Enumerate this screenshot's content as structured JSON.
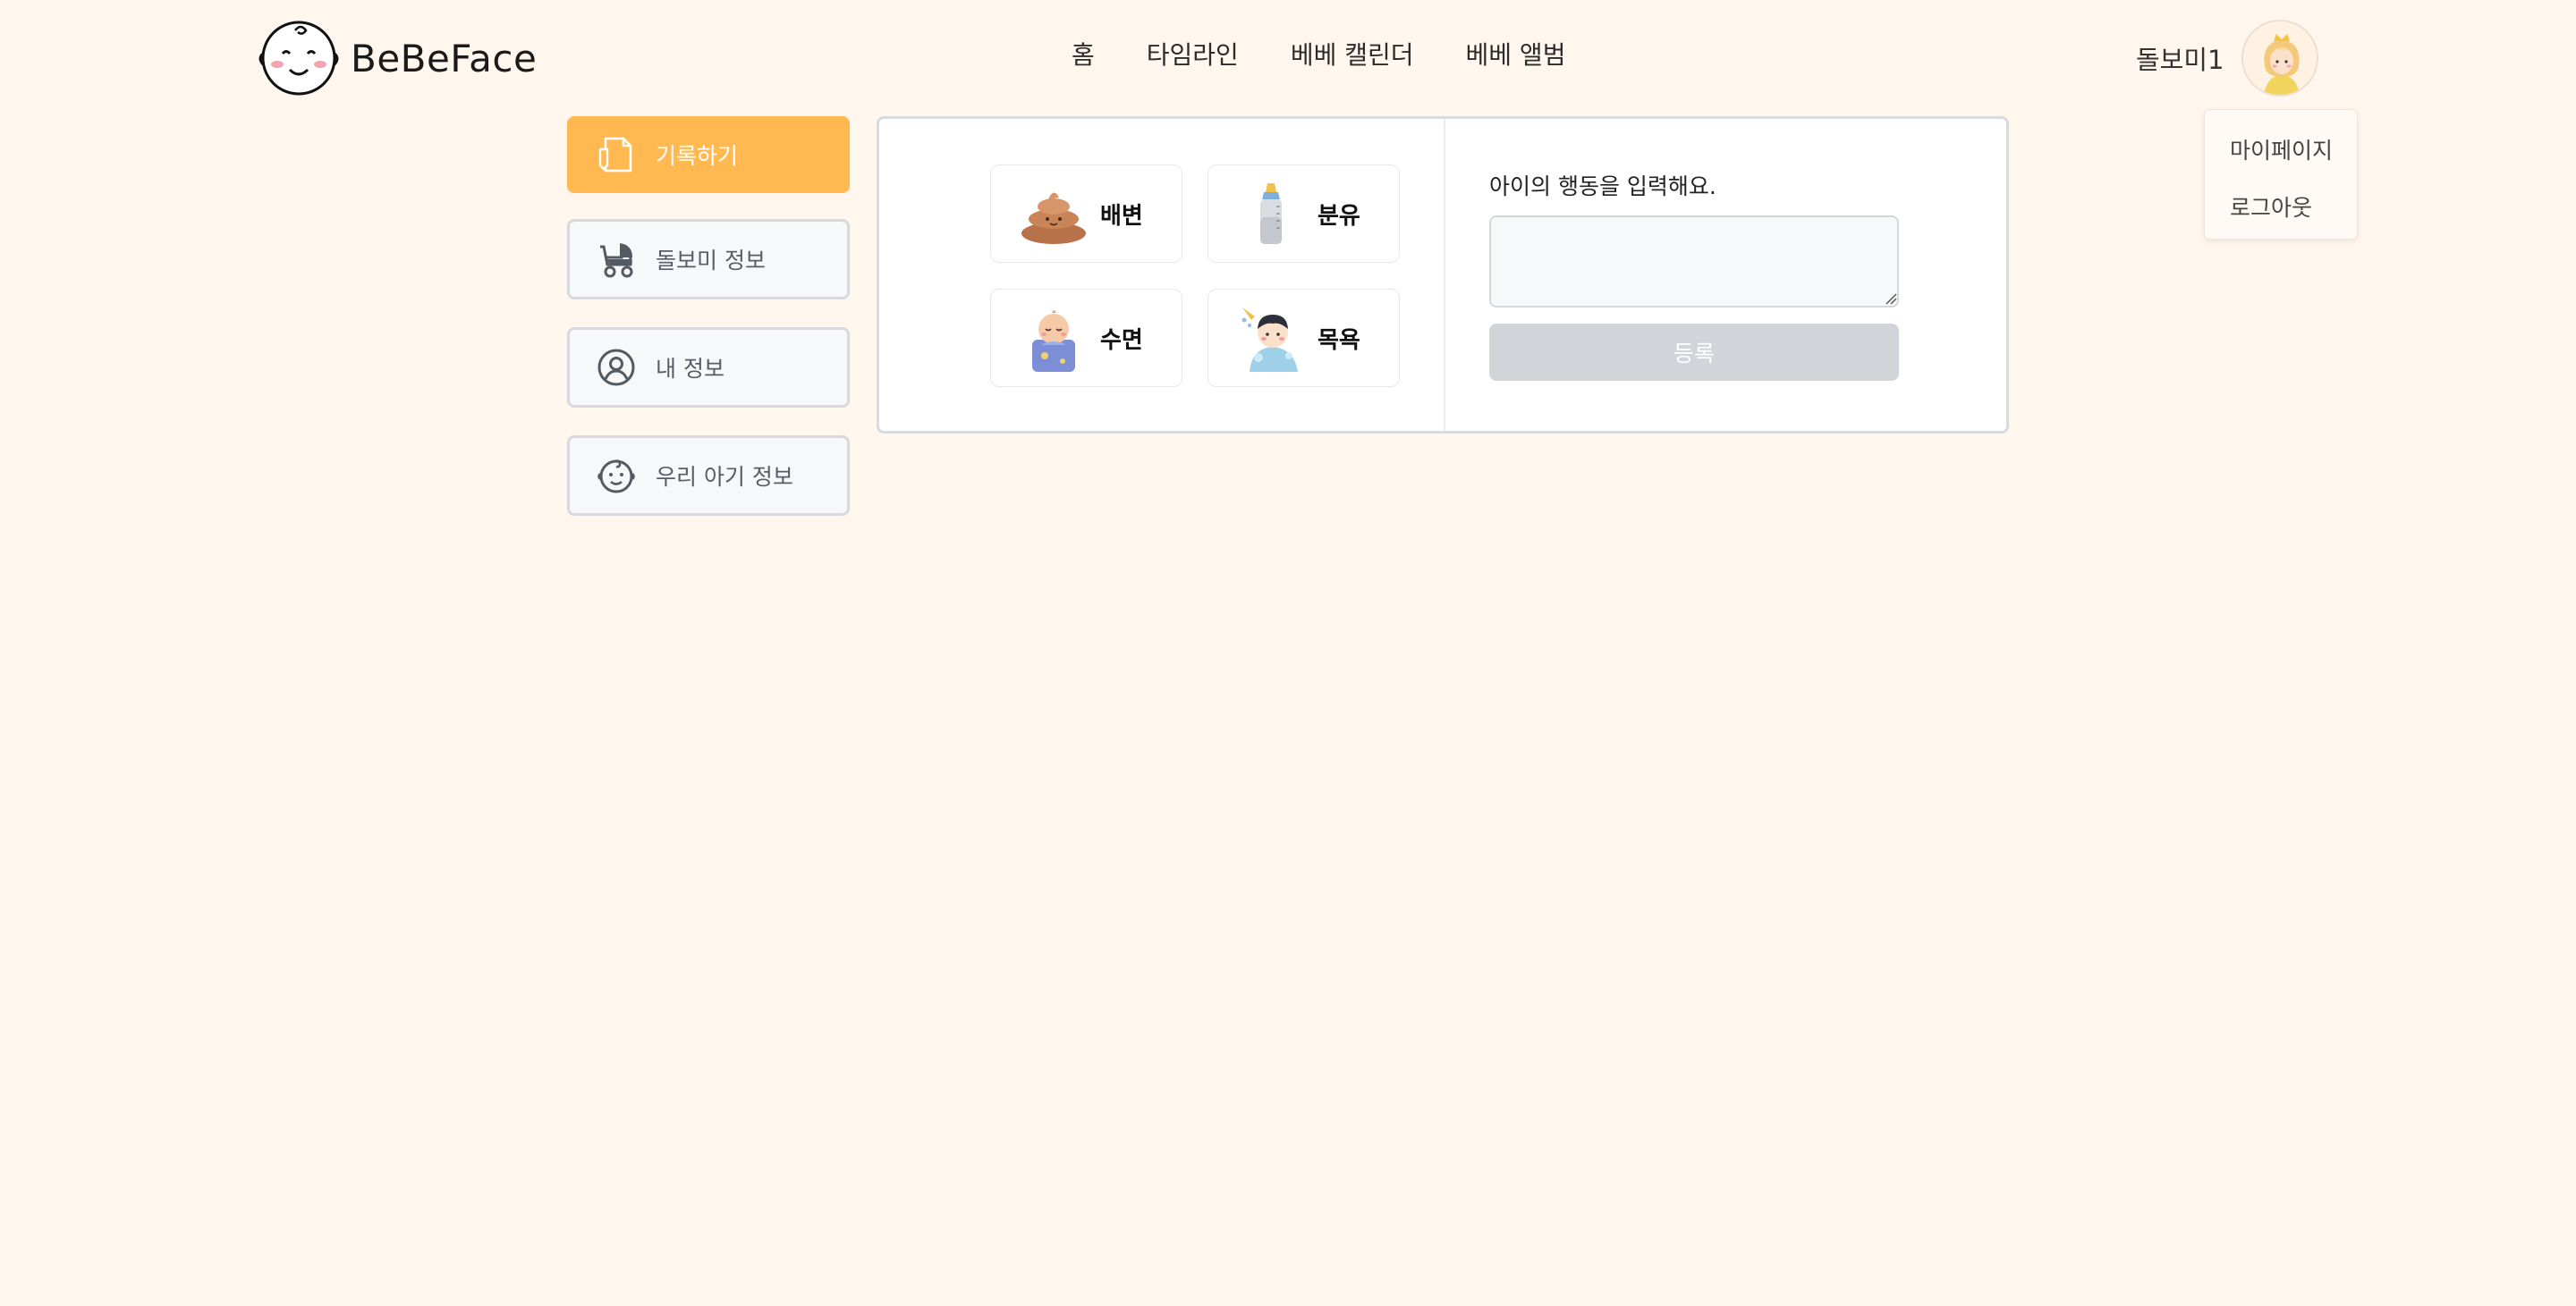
{
  "header": {
    "logo_text": "BeBeFace",
    "nav": [
      {
        "label": "홈"
      },
      {
        "label": "타임라인"
      },
      {
        "label": "베베 캘린더"
      },
      {
        "label": "베베 앨범"
      }
    ],
    "user_name": "돌보미1"
  },
  "user_menu": {
    "items": [
      {
        "label": "마이페이지"
      },
      {
        "label": "로그아웃"
      }
    ]
  },
  "sidebar": {
    "items": [
      {
        "label": "기록하기",
        "icon": "document-pen-icon",
        "active": true
      },
      {
        "label": "돌보미 정보",
        "icon": "stroller-icon",
        "active": false
      },
      {
        "label": "내 정보",
        "icon": "user-circle-icon",
        "active": false
      },
      {
        "label": "우리 아기 정보",
        "icon": "baby-face-icon",
        "active": false
      }
    ]
  },
  "record": {
    "activities": [
      {
        "label": "배변",
        "icon": "poop-icon"
      },
      {
        "label": "분유",
        "icon": "baby-bottle-icon"
      },
      {
        "label": "수면",
        "icon": "sleeping-baby-icon"
      },
      {
        "label": "목욕",
        "icon": "bathing-baby-icon"
      }
    ],
    "prompt": "아이의 행동을 입력해요.",
    "input_value": "",
    "submit_label": "등록"
  },
  "colors": {
    "background": "#fff6ed",
    "accent": "#ffb950",
    "disabled_button": "#d1d4d9",
    "border": "#d7dadf"
  }
}
